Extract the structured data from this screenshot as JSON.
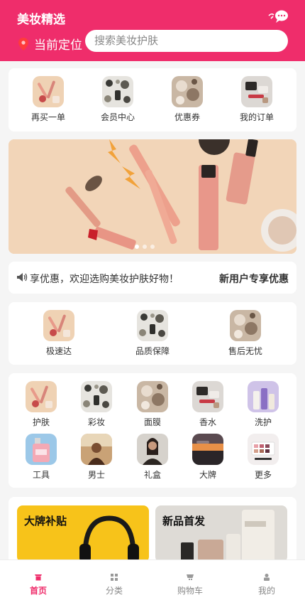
{
  "header": {
    "title": "美妆精选",
    "location_label": "当前定位",
    "search_placeholder": "搜索美妆护肤"
  },
  "quick_actions": [
    {
      "label": "再买一单",
      "icon": "cosmetics-flatlay-thumb"
    },
    {
      "label": "会员中心",
      "icon": "makeup-set-thumb"
    },
    {
      "label": "优惠券",
      "icon": "skincare-thumb"
    },
    {
      "label": "我的订单",
      "icon": "makeup-kit-thumb"
    }
  ],
  "banner": {
    "image": "cosmetics-banner-image",
    "slide_count": 3,
    "active_slide": 1
  },
  "notice": {
    "icon": "speaker-icon",
    "text": "享优惠，欢迎选购美妆护肤好物！",
    "right_text": "新用户专享优惠"
  },
  "services": [
    {
      "label": "极速达",
      "icon": "cosmetics-flatlay-thumb"
    },
    {
      "label": "品质保障",
      "icon": "makeup-set-thumb"
    },
    {
      "label": "售后无忧",
      "icon": "skincare-thumb"
    }
  ],
  "categories": [
    {
      "label": "护肤",
      "icon": "cosmetics-flatlay-thumb"
    },
    {
      "label": "彩妆",
      "icon": "makeup-set-thumb"
    },
    {
      "label": "面膜",
      "icon": "skincare-thumb"
    },
    {
      "label": "香水",
      "icon": "makeup-kit-thumb"
    },
    {
      "label": "洗护",
      "icon": "bottles-thumb"
    },
    {
      "label": "工具",
      "icon": "perfume-thumb"
    },
    {
      "label": "男士",
      "icon": "portrait-thumb"
    },
    {
      "label": "礼盒",
      "icon": "model-thumb"
    },
    {
      "label": "大牌",
      "icon": "sunset-thumb"
    },
    {
      "label": "更多",
      "icon": "palette-thumb"
    }
  ],
  "promos": [
    {
      "title": "大牌补贴",
      "image": "headphones-image"
    },
    {
      "title": "新品首发",
      "image": "skincare-bottles-image"
    }
  ],
  "tabbar": [
    {
      "label": "首页",
      "icon": "home-icon",
      "active": true
    },
    {
      "label": "分类",
      "icon": "grid-icon",
      "active": false
    },
    {
      "label": "购物车",
      "icon": "cart-icon",
      "active": false
    },
    {
      "label": "我的",
      "icon": "user-icon",
      "active": false
    }
  ],
  "colors": {
    "brand": "#ef2d6b",
    "background": "#f5f5f5",
    "banner_bg": "#f2d5b8"
  }
}
